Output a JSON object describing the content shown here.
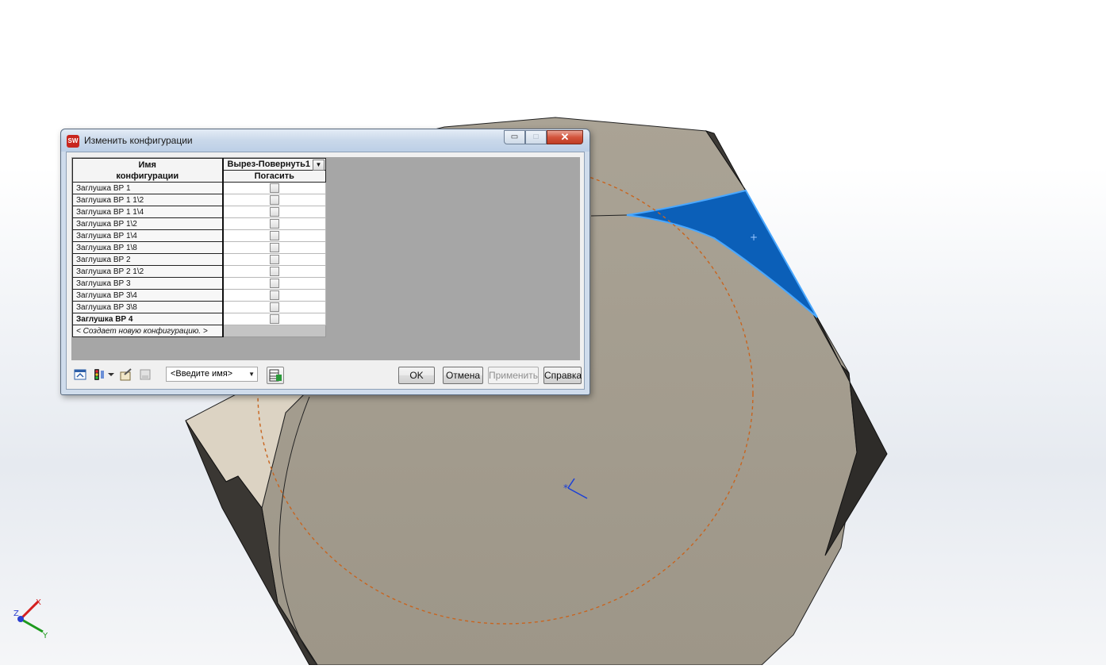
{
  "dialog": {
    "title": "Изменить конфигурации",
    "app_icon_text": "SW",
    "window_buttons": {
      "minimize": "▭",
      "maximize": "□",
      "close": "✕"
    },
    "table": {
      "name_header": "Имя\nконфигурации",
      "feature_header": "Вырез-Повернуть1",
      "feature_subheader": "Погасить",
      "rows": [
        {
          "name": "Заглушка ВР 1",
          "suppressed": false,
          "bold": false
        },
        {
          "name": "Заглушка ВР 1 1\\2",
          "suppressed": false,
          "bold": false
        },
        {
          "name": "Заглушка ВР 1 1\\4",
          "suppressed": false,
          "bold": false
        },
        {
          "name": "Заглушка ВР 1\\2",
          "suppressed": false,
          "bold": false
        },
        {
          "name": "Заглушка ВР 1\\4",
          "suppressed": false,
          "bold": false
        },
        {
          "name": "Заглушка ВР 1\\8",
          "suppressed": false,
          "bold": false
        },
        {
          "name": "Заглушка ВР 2",
          "suppressed": false,
          "bold": false
        },
        {
          "name": "Заглушка ВР 2 1\\2",
          "suppressed": false,
          "bold": false
        },
        {
          "name": "Заглушка ВР 3",
          "suppressed": false,
          "bold": false
        },
        {
          "name": "Заглушка ВР 3\\4",
          "suppressed": false,
          "bold": false
        },
        {
          "name": "Заглушка ВР 3\\8",
          "suppressed": false,
          "bold": false
        },
        {
          "name": "Заглушка ВР 4",
          "suppressed": false,
          "bold": true
        }
      ],
      "new_config_row": "< Создает новую конфигурацию. >"
    },
    "footer": {
      "icons": [
        "table-settings-icon",
        "traffic-light-icon",
        "dropdown-arrow-icon",
        "edit-table-icon",
        "save-view-icon"
      ],
      "view_name_placeholder": "<Введите имя>",
      "buttons": {
        "ok": "OK",
        "cancel": "Отмена",
        "apply": "Применить",
        "help": "Справка"
      },
      "apply_enabled": false
    }
  },
  "triad": {
    "x": "X",
    "y": "Y",
    "z": "Z"
  },
  "colors": {
    "selected_face": "#0b5fb8",
    "part_face": "#a09a8c",
    "sketch_circle": "#c8641e"
  }
}
